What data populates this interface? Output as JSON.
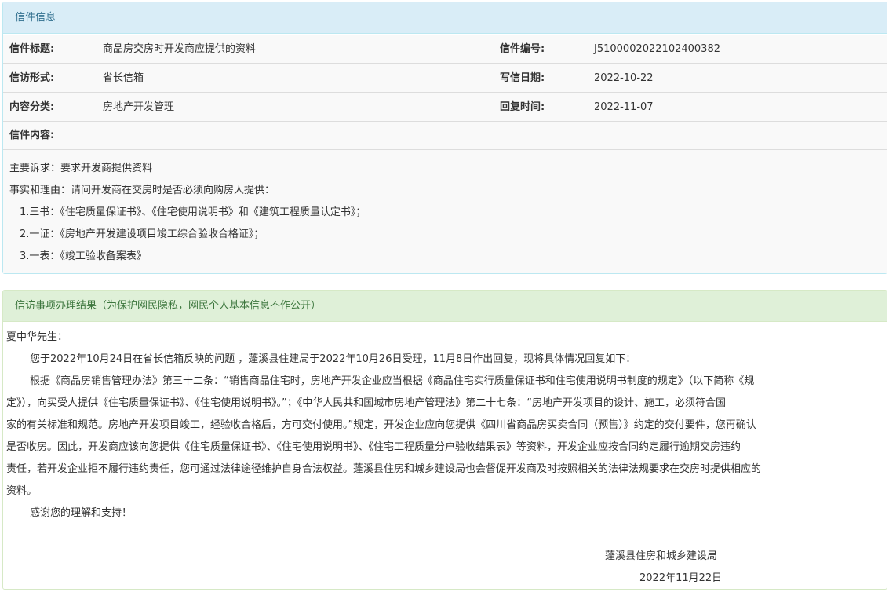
{
  "letter_panel": {
    "title": "信件信息",
    "rows": [
      {
        "label1": "信件标题:",
        "value1": "商品房交房时开发商应提供的资料",
        "label2": "信件编号:",
        "value2": "J5100002022102400382"
      },
      {
        "label1": "信访形式:",
        "value1": "省长信箱",
        "label2": "写信日期:",
        "value2": "2022-10-22"
      },
      {
        "label1": "内容分类:",
        "value1": "房地产开发管理",
        "label2": "回复时间:",
        "value2": "2022-11-07"
      }
    ],
    "content_label": "信件内容:",
    "content_lines": [
      "主要诉求：要求开发商提供资料",
      "事实和理由：请问开发商在交房时是否必须向购房人提供：",
      "　1.三书：《住宅质量保证书》、《住宅使用说明书》和《建筑工程质量认定书》；",
      "　2.一证：《房地产开发建设项目竣工综合验收合格证》；",
      "　3.一表：《竣工验收备案表》"
    ]
  },
  "reply_panel": {
    "title": "信访事项办理结果（为保护网民隐私，网民个人基本信息不作公开）",
    "salutation": "夏中华先生：",
    "paragraph1": "您于2022年10月24日在省长信箱反映的问题 ，蓬溪县住建局于2022年10月26日受理，11月8日作出回复，现将具体情况回复如下：",
    "paragraph2_lines": [
      "根据《商品房销售管理办法》第三十二条：“销售商品住宅时，房地产开发企业应当根据《商品住宅实行质量保证书和住宅使用说明书制度的规定》（以下简称《规",
      "定》），向买受人提供《住宅质量保证书》、《住宅使用说明书》。”；《中华人民共和国城市房地产管理法》第二十七条：“房地产开发项目的设计、施工，必须符合国",
      "家的有关标准和规范。房地产开发项目竣工，经验收合格后，方可交付使用。”规定，开发企业应向您提供《四川省商品房买卖合同（预售）》约定的交付要件，您再确认",
      "是否收房。因此，开发商应该向您提供《住宅质量保证书》、《住宅使用说明书》、《住宅工程质量分户验收结果表》等资料，开发企业应按合同约定履行逾期交房违约",
      "责任，若开发企业拒不履行违约责任，您可通过法律途径维护自身合法权益。蓬溪县住房和城乡建设局也会督促开发商及时按照相关的法律法规要求在交房时提供相应的",
      "资料。"
    ],
    "thanks": "感谢您的理解和支持！",
    "signature_org": "蓬溪县住房和城乡建设局",
    "signature_date": "2022年11月22日"
  }
}
